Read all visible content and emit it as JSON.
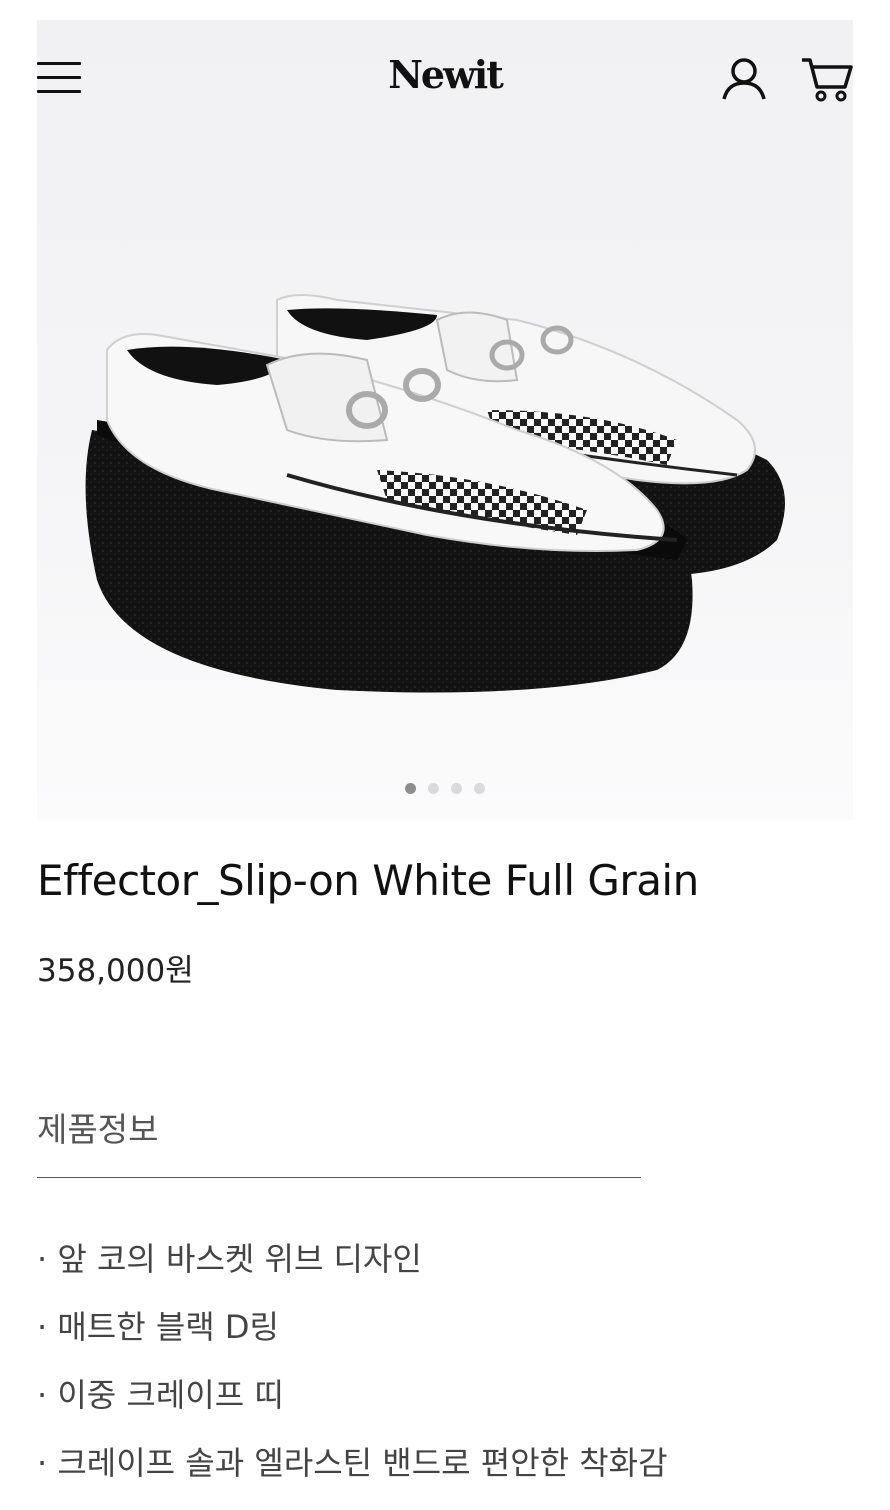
{
  "header": {
    "logo": "Newit",
    "menu_icon": "hamburger-menu-icon",
    "user_icon": "user-icon",
    "cart_icon": "cart-icon"
  },
  "gallery": {
    "image": "white slip-on creeper shoes with black crepe sole",
    "slide_count": 4,
    "active_index": 0
  },
  "product": {
    "title": "Effector_Slip-on White Full Grain",
    "price": "358,000원"
  },
  "info": {
    "label": "제품정보",
    "features": [
      "· 앞 코의 바스켓 위브 디자인",
      "· 매트한 블랙 D링",
      "· 이중 크레이프 띠",
      "· 크레이프 솔과 엘라스틴 밴드로 편안한 착화감"
    ]
  },
  "colors": {
    "text": "#111111",
    "secondary_text": "#444444",
    "dot_active": "#8d8d8d",
    "dot_inactive": "#d9d9d9"
  }
}
